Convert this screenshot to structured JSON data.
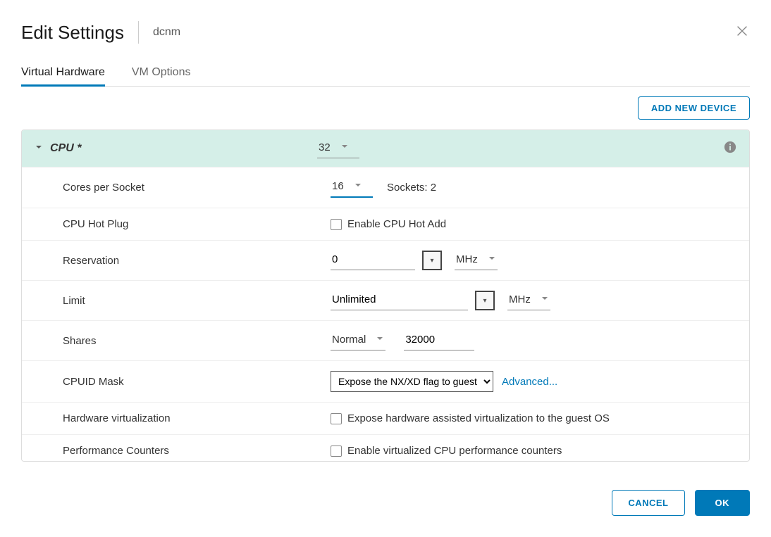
{
  "header": {
    "title": "Edit Settings",
    "subtitle": "dcnm"
  },
  "tabs": {
    "virtual_hardware": "Virtual Hardware",
    "vm_options": "VM Options"
  },
  "toolbar": {
    "add_device": "ADD NEW DEVICE"
  },
  "cpu": {
    "section_label": "CPU *",
    "count": "32",
    "rows": {
      "cores_label": "Cores per Socket",
      "cores_value": "16",
      "sockets_text": "Sockets: 2",
      "hotplug_label": "CPU Hot Plug",
      "hotplug_checkbox": "Enable CPU Hot Add",
      "reservation_label": "Reservation",
      "reservation_value": "0",
      "reservation_unit": "MHz",
      "limit_label": "Limit",
      "limit_value": "Unlimited",
      "limit_unit": "MHz",
      "shares_label": "Shares",
      "shares_level": "Normal",
      "shares_value": "32000",
      "cpuid_label": "CPUID Mask",
      "cpuid_value": "Expose the NX/XD flag to guest",
      "cpuid_advanced": "Advanced...",
      "hwvirt_label": "Hardware virtualization",
      "hwvirt_checkbox": "Expose hardware assisted virtualization to the guest OS",
      "perfcnt_label": "Performance Counters",
      "perfcnt_checkbox": "Enable virtualized CPU performance counters"
    }
  },
  "footer": {
    "cancel": "CANCEL",
    "ok": "OK"
  }
}
